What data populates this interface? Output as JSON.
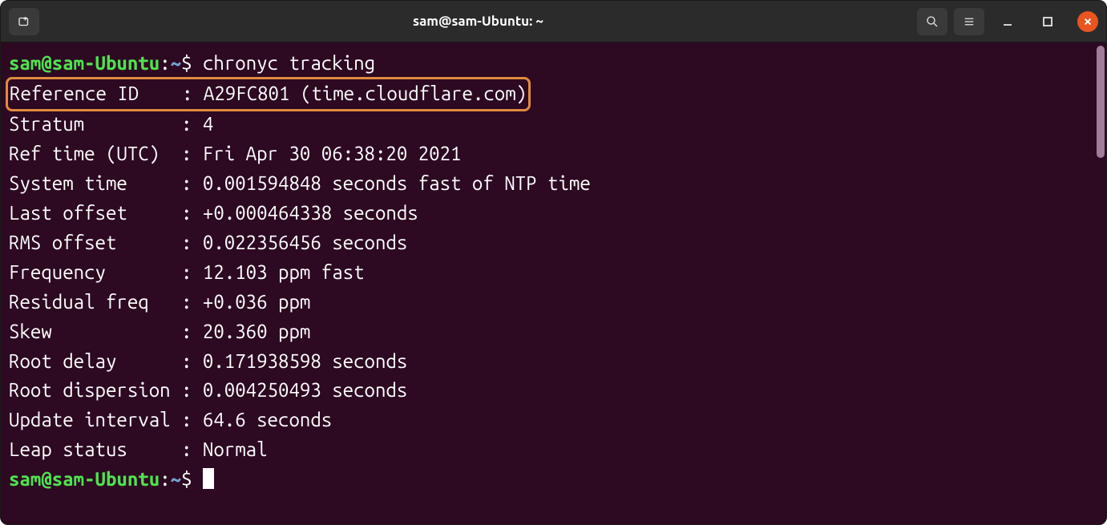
{
  "titlebar": {
    "title": "sam@sam-Ubuntu: ~"
  },
  "prompt": {
    "user_host": "sam@sam-Ubuntu",
    "colon": ":",
    "cwd": "~",
    "symbol": "$"
  },
  "command": "chronyc tracking",
  "output": {
    "rows": [
      {
        "label": "Reference ID   ",
        "value": "A29FC801 (time.cloudflare.com)",
        "highlighted": true
      },
      {
        "label": "Stratum        ",
        "value": "4"
      },
      {
        "label": "Ref time (UTC) ",
        "value": "Fri Apr 30 06:38:20 2021"
      },
      {
        "label": "System time    ",
        "value": "0.001594848 seconds fast of NTP time"
      },
      {
        "label": "Last offset    ",
        "value": "+0.000464338 seconds"
      },
      {
        "label": "RMS offset     ",
        "value": "0.022356456 seconds"
      },
      {
        "label": "Frequency      ",
        "value": "12.103 ppm fast"
      },
      {
        "label": "Residual freq  ",
        "value": "+0.036 ppm"
      },
      {
        "label": "Skew           ",
        "value": "20.360 ppm"
      },
      {
        "label": "Root delay     ",
        "value": "0.171938598 seconds"
      },
      {
        "label": "Root dispersion",
        "value": "0.004250493 seconds"
      },
      {
        "label": "Update interval",
        "value": "64.6 seconds"
      },
      {
        "label": "Leap status    ",
        "value": "Normal"
      }
    ]
  }
}
